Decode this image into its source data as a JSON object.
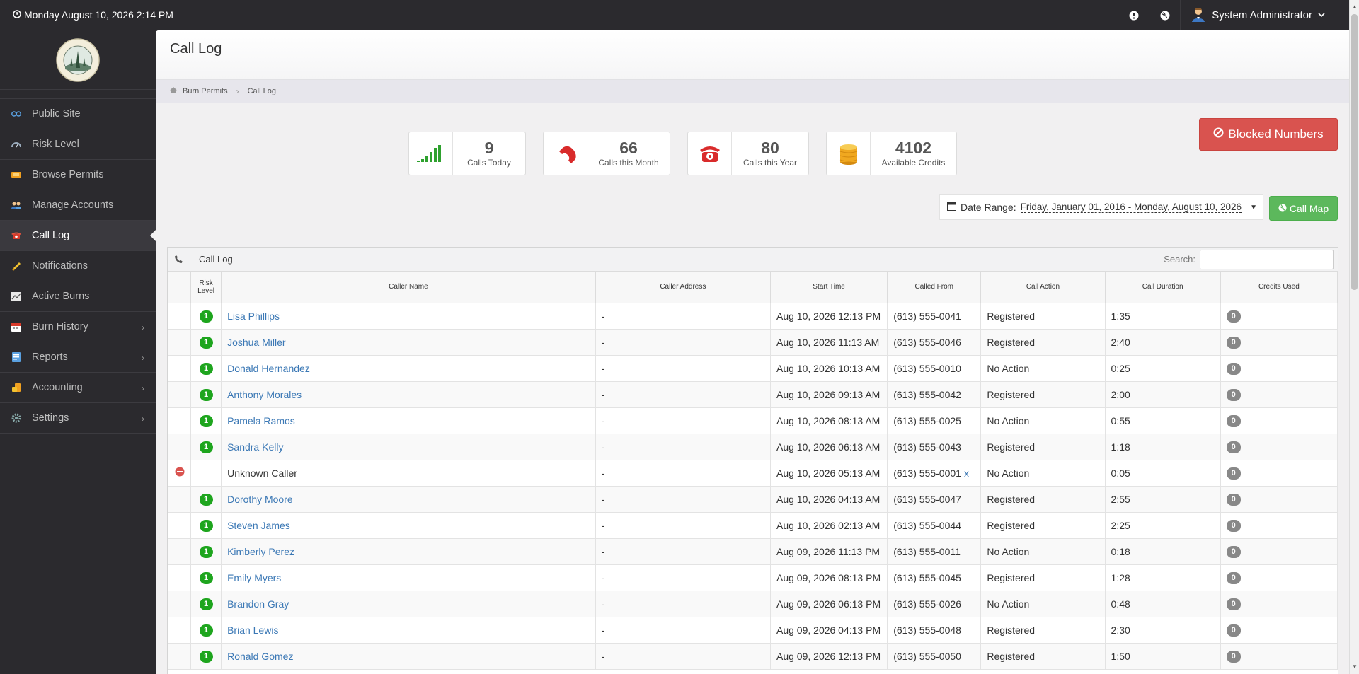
{
  "topbar": {
    "datetime": "Monday August 10, 2026 2:14 PM",
    "user_name": "System Administrator"
  },
  "sidebar": {
    "items": [
      {
        "label": "Public Site",
        "icon": "link-icon"
      },
      {
        "label": "Risk Level",
        "icon": "gauge-icon"
      },
      {
        "label": "Browse Permits",
        "icon": "ticket-icon"
      },
      {
        "label": "Manage Accounts",
        "icon": "users-icon"
      },
      {
        "label": "Call Log",
        "icon": "phone-icon"
      },
      {
        "label": "Notifications",
        "icon": "bell-icon"
      },
      {
        "label": "Active Burns",
        "icon": "chart-icon"
      },
      {
        "label": "Burn History",
        "icon": "calendar-icon"
      },
      {
        "label": "Reports",
        "icon": "report-icon"
      },
      {
        "label": "Accounting",
        "icon": "coins-icon"
      },
      {
        "label": "Settings",
        "icon": "gear-icon"
      }
    ]
  },
  "page": {
    "title": "Call Log",
    "breadcrumb": [
      "Burn Permits",
      "Call Log"
    ]
  },
  "stats": [
    {
      "value": "9",
      "label": "Calls Today"
    },
    {
      "value": "66",
      "label": "Calls this Month"
    },
    {
      "value": "80",
      "label": "Calls this Year"
    },
    {
      "value": "4102",
      "label": "Available Credits"
    }
  ],
  "buttons": {
    "blocked": "Blocked Numbers",
    "call_map": "Call Map"
  },
  "date_range": {
    "label": "Date Range:",
    "value": "Friday, January 01, 2016 - Monday, August 10, 2026"
  },
  "table": {
    "title": "Call Log",
    "search_label": "Search:",
    "headers": [
      "Risk Level",
      "Caller Name",
      "Caller Address",
      "Start Time",
      "Called From",
      "Call Action",
      "Call Duration",
      "Credits Used"
    ],
    "rows": [
      {
        "risk": "1",
        "name": "Lisa Phillips",
        "address": "-",
        "start": "Aug 10, 2026 12:13 PM",
        "from": "(613) 555-0041",
        "action": "Registered",
        "duration": "1:35",
        "credits": "0"
      },
      {
        "risk": "1",
        "name": "Joshua Miller",
        "address": "-",
        "start": "Aug 10, 2026 11:13 AM",
        "from": "(613) 555-0046",
        "action": "Registered",
        "duration": "2:40",
        "credits": "0"
      },
      {
        "risk": "1",
        "name": "Donald Hernandez",
        "address": "-",
        "start": "Aug 10, 2026 10:13 AM",
        "from": "(613) 555-0010",
        "action": "No Action",
        "duration": "0:25",
        "credits": "0"
      },
      {
        "risk": "1",
        "name": "Anthony Morales",
        "address": "-",
        "start": "Aug 10, 2026 09:13 AM",
        "from": "(613) 555-0042",
        "action": "Registered",
        "duration": "2:00",
        "credits": "0"
      },
      {
        "risk": "1",
        "name": "Pamela Ramos",
        "address": "-",
        "start": "Aug 10, 2026 08:13 AM",
        "from": "(613) 555-0025",
        "action": "No Action",
        "duration": "0:55",
        "credits": "0"
      },
      {
        "risk": "1",
        "name": "Sandra Kelly",
        "address": "-",
        "start": "Aug 10, 2026 06:13 AM",
        "from": "(613) 555-0043",
        "action": "Registered",
        "duration": "1:18",
        "credits": "0"
      },
      {
        "risk": "",
        "name": "Unknown Caller",
        "address": "-",
        "start": "Aug 10, 2026 05:13 AM",
        "from": "(613) 555-0001",
        "from_extra": "x",
        "action": "No Action",
        "duration": "0:05",
        "credits": "0",
        "blocked": true
      },
      {
        "risk": "1",
        "name": "Dorothy Moore",
        "address": "-",
        "start": "Aug 10, 2026 04:13 AM",
        "from": "(613) 555-0047",
        "action": "Registered",
        "duration": "2:55",
        "credits": "0"
      },
      {
        "risk": "1",
        "name": "Steven James",
        "address": "-",
        "start": "Aug 10, 2026 02:13 AM",
        "from": "(613) 555-0044",
        "action": "Registered",
        "duration": "2:25",
        "credits": "0"
      },
      {
        "risk": "1",
        "name": "Kimberly Perez",
        "address": "-",
        "start": "Aug 09, 2026 11:13 PM",
        "from": "(613) 555-0011",
        "action": "No Action",
        "duration": "0:18",
        "credits": "0"
      },
      {
        "risk": "1",
        "name": "Emily Myers",
        "address": "-",
        "start": "Aug 09, 2026 08:13 PM",
        "from": "(613) 555-0045",
        "action": "Registered",
        "duration": "1:28",
        "credits": "0"
      },
      {
        "risk": "1",
        "name": "Brandon Gray",
        "address": "-",
        "start": "Aug 09, 2026 06:13 PM",
        "from": "(613) 555-0026",
        "action": "No Action",
        "duration": "0:48",
        "credits": "0"
      },
      {
        "risk": "1",
        "name": "Brian Lewis",
        "address": "-",
        "start": "Aug 09, 2026 04:13 PM",
        "from": "(613) 555-0048",
        "action": "Registered",
        "duration": "2:30",
        "credits": "0"
      },
      {
        "risk": "1",
        "name": "Ronald Gomez",
        "address": "-",
        "start": "Aug 09, 2026 12:13 PM",
        "from": "(613) 555-0050",
        "action": "Registered",
        "duration": "1:50",
        "credits": "0"
      }
    ]
  },
  "colors": {
    "sidebar_bg": "#2b2a2e",
    "danger": "#d9534f",
    "success": "#5cb85c",
    "link": "#3b78b5",
    "risk_badge": "#1ea51e"
  }
}
